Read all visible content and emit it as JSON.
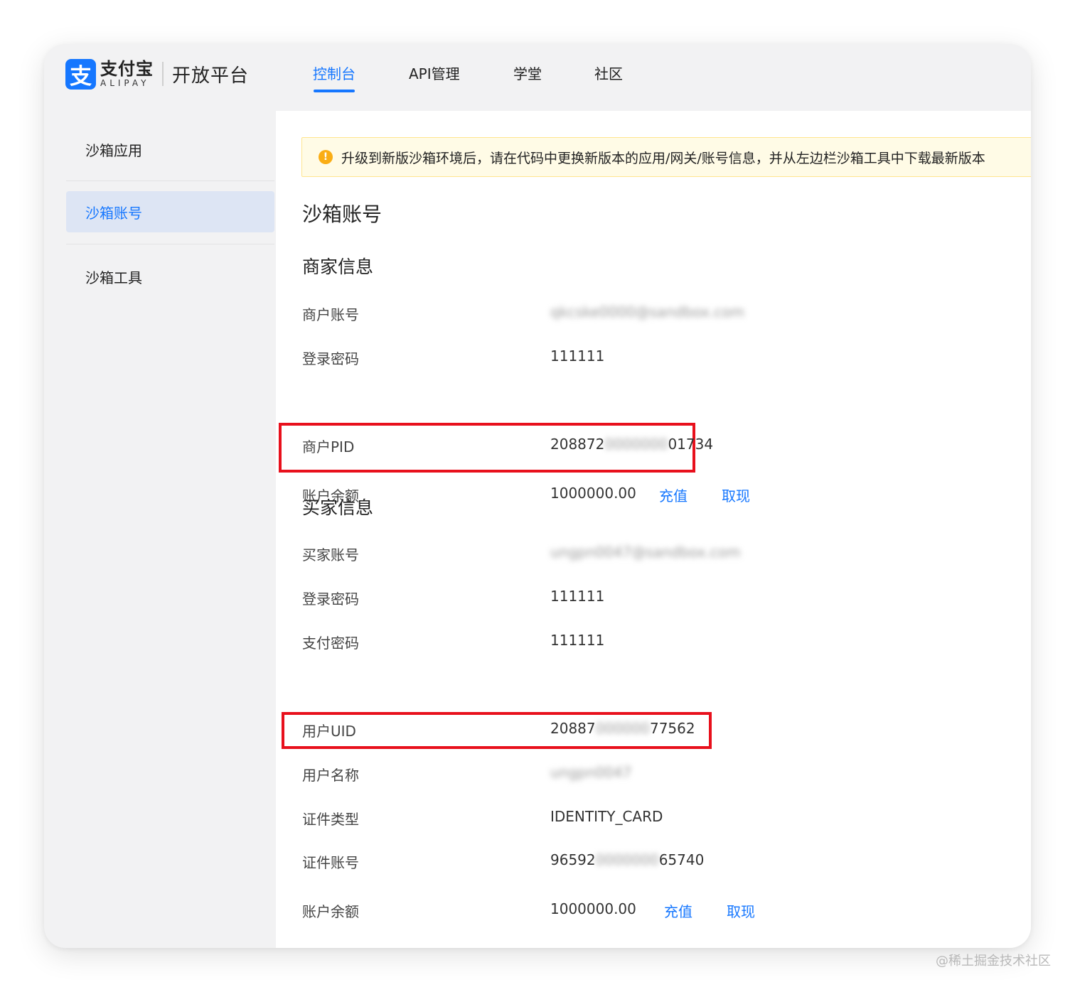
{
  "header": {
    "logo_cn": "支付宝",
    "logo_en": "ALIPAY",
    "platform": "开放平台",
    "nav": [
      {
        "label": "控制台",
        "active": true
      },
      {
        "label": "API管理",
        "active": false
      },
      {
        "label": "学堂",
        "active": false
      },
      {
        "label": "社区",
        "active": false
      }
    ]
  },
  "sidebar": {
    "items": [
      {
        "label": "沙箱应用",
        "active": false
      },
      {
        "label": "沙箱账号",
        "active": true
      },
      {
        "label": "沙箱工具",
        "active": false
      }
    ]
  },
  "alert": {
    "icon": "warning-icon",
    "text": "升级到新版沙箱环境后，请在代码中更换新版本的应用/网关/账号信息，并从左边栏沙箱工具中下载最新版本"
  },
  "page": {
    "title": "沙箱账号",
    "merchant": {
      "title": "商家信息",
      "account_label": "商户账号",
      "account_value": "qkcske0000@sandbox.com",
      "password_label": "登录密码",
      "password_value": "111111",
      "pid_label": "商户PID",
      "pid_prefix": "208872",
      "pid_hidden": "0000000",
      "pid_suffix": "01734",
      "balance_label": "账户余额",
      "balance_value": "1000000.00",
      "recharge": "充值",
      "withdraw": "取现"
    },
    "buyer": {
      "title": "买家信息",
      "account_label": "买家账号",
      "account_value": "ungpn0047@sandbox.com",
      "password_label": "登录密码",
      "password_value": "111111",
      "paypwd_label": "支付密码",
      "paypwd_value": "111111",
      "uid_label": "用户UID",
      "uid_prefix": "20887",
      "uid_hidden": "000000",
      "uid_suffix": "77562",
      "name_label": "用户名称",
      "name_value": "ungpn0047",
      "idtype_label": "证件类型",
      "idtype_value": "IDENTITY_CARD",
      "idno_label": "证件账号",
      "idno_prefix": "96592",
      "idno_hidden": "0000000",
      "idno_suffix": "65740",
      "balance_label": "账户余额",
      "balance_value": "1000000.00",
      "recharge": "充值",
      "withdraw": "取现"
    }
  },
  "watermark": "@稀土掘金技术社区",
  "colors": {
    "accent": "#1677ff",
    "highlight_border": "#e8101c",
    "alert_bg": "#fffbe6",
    "alert_icon": "#faad14"
  }
}
